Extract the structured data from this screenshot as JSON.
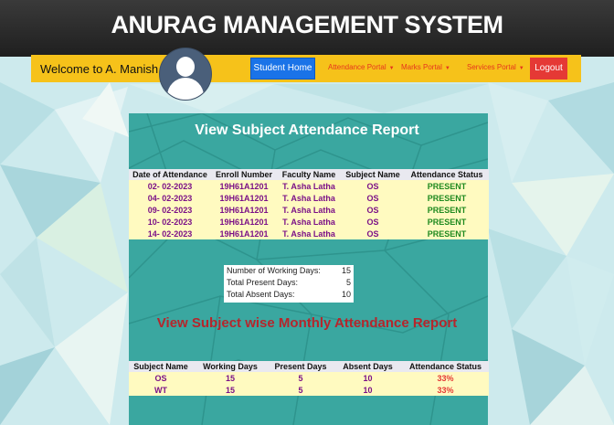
{
  "app": {
    "title": "ANURAG MANAGEMENT SYSTEM"
  },
  "navbar": {
    "welcome": "Welcome to A. Manish",
    "home_label": "Student Home",
    "menus": [
      "Attendance Portal",
      "Marks Portal",
      "Services Portal"
    ],
    "logout_label": "Logout"
  },
  "attendance_report": {
    "title": "View Subject Attendance Report",
    "columns": [
      "Date of Attendance",
      "Enroll Number",
      "Faculty Name",
      "Subject Name",
      "Attendance Status"
    ],
    "rows": [
      [
        "02- 02-2023",
        "19H61A1201",
        "T. Asha Latha",
        "OS",
        "PRESENT"
      ],
      [
        "04- 02-2023",
        "19H61A1201",
        "T. Asha Latha",
        "OS",
        "PRESENT"
      ],
      [
        "09- 02-2023",
        "19H61A1201",
        "T. Asha Latha",
        "OS",
        "PRESENT"
      ],
      [
        "10- 02-2023",
        "19H61A1201",
        "T. Asha Latha",
        "OS",
        "PRESENT"
      ],
      [
        "14- 02-2023",
        "19H61A1201",
        "T. Asha Latha",
        "OS",
        "PRESENT"
      ]
    ]
  },
  "summary": {
    "working_label": "Number of Working Days:",
    "working_value": "15",
    "present_label": "Total Present Days:",
    "present_value": "5",
    "absent_label": "Total Absent Days:",
    "absent_value": "10"
  },
  "monthly_report": {
    "title": "View Subject wise Monthly Attendance Report",
    "columns": [
      "Subject Name",
      "Working Days",
      "Present Days",
      "Absent Days",
      "Attendance Status"
    ],
    "rows": [
      [
        "OS",
        "15",
        "5",
        "10",
        "33%"
      ],
      [
        "WT",
        "15",
        "5",
        "10",
        "33%"
      ]
    ]
  },
  "colors": {
    "header_bg": "#2b2b2b",
    "navbar": "#f6c21a",
    "home_button": "#1a73e8",
    "logout_button": "#e53935",
    "panel": "#3aa7a0",
    "row_bg": "#fffac0",
    "present": "#1f8a1f",
    "monthly_title": "#b5262c"
  },
  "icons": {
    "avatar": "user-avatar-icon",
    "caret": "caret-down-icon"
  }
}
